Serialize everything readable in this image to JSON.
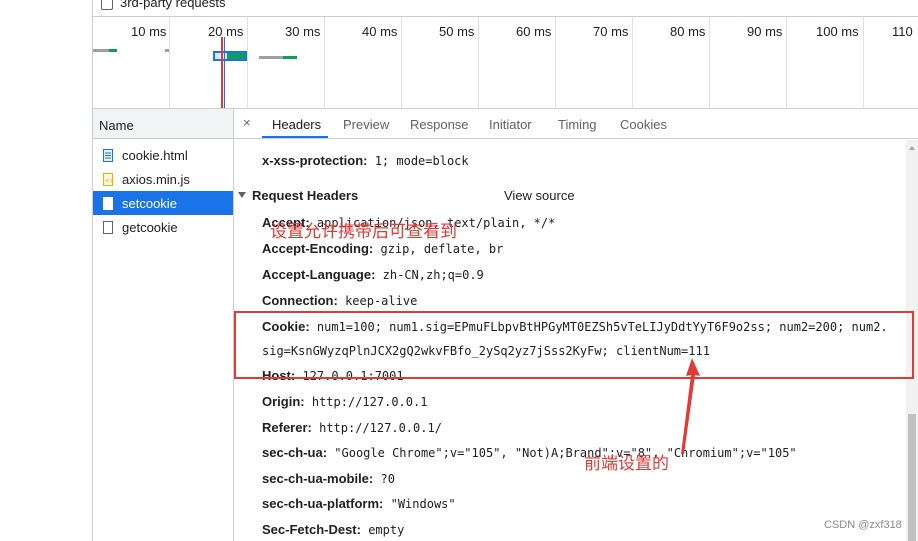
{
  "filter": {
    "third_party_label": "3rd-party requests"
  },
  "timeline": {
    "ticks": [
      "10 ms",
      "20 ms",
      "30 ms",
      "40 ms",
      "50 ms",
      "60 ms",
      "70 ms",
      "80 ms",
      "90 ms",
      "100 ms",
      "110"
    ]
  },
  "requests": {
    "header": "Name",
    "items": [
      {
        "name": "cookie.html",
        "icon": "document-icon"
      },
      {
        "name": "axios.min.js",
        "icon": "script-icon"
      },
      {
        "name": "setcookie",
        "icon": "xhr-icon",
        "selected": true
      },
      {
        "name": "getcookie",
        "icon": "blank-file-icon"
      }
    ]
  },
  "tabs": {
    "close": "×",
    "items": [
      "Headers",
      "Preview",
      "Response",
      "Initiator",
      "Timing",
      "Cookies"
    ],
    "active": "Headers"
  },
  "response_headers_tail": [
    {
      "key": "x-xss-protection:",
      "value": "1; mode=block"
    }
  ],
  "request_headers": {
    "title": "Request Headers",
    "view_source": "View source",
    "rows": [
      {
        "key": "Accept:",
        "value": "application/json, text/plain, */*"
      },
      {
        "key": "Accept-Encoding:",
        "value": "gzip, deflate, br"
      },
      {
        "key": "Accept-Language:",
        "value": "zh-CN,zh;q=0.9"
      },
      {
        "key": "Connection:",
        "value": "keep-alive"
      },
      {
        "key": "Cookie:",
        "value": "num1=100; num1.sig=EPmuFLbpvBtHPGyMT0EZSh5vTeLIJyDdtYyT6F9o2ss; num2=200; num2.",
        "value2": "sig=KsnGWyzqPlnJCX2gQ2wkvFBfo_2ySq2yz7jSss2KyFw; clientNum=111"
      },
      {
        "key": "Host:",
        "value": "127.0.0.1:7001"
      },
      {
        "key": "Origin:",
        "value": "http://127.0.0.1"
      },
      {
        "key": "Referer:",
        "value": "http://127.0.0.1/"
      },
      {
        "key": "sec-ch-ua:",
        "value": "\"Google Chrome\";v=\"105\", \"Not)A;Brand\";v=\"8\", \"Chromium\";v=\"105\""
      },
      {
        "key": "sec-ch-ua-mobile:",
        "value": "?0"
      },
      {
        "key": "sec-ch-ua-platform:",
        "value": "\"Windows\""
      },
      {
        "key": "Sec-Fetch-Dest:",
        "value": "empty"
      }
    ]
  },
  "annotations": {
    "top_note": "设置允许携带后可查看到",
    "bottom_note": "前端设置的",
    "watermark": "CSDN @zxf318"
  },
  "colors": {
    "accent": "#1a73e8",
    "annotation_red": "#e53935",
    "bar_green": "#0f9d58",
    "bar_gray": "#9aa0a6"
  }
}
